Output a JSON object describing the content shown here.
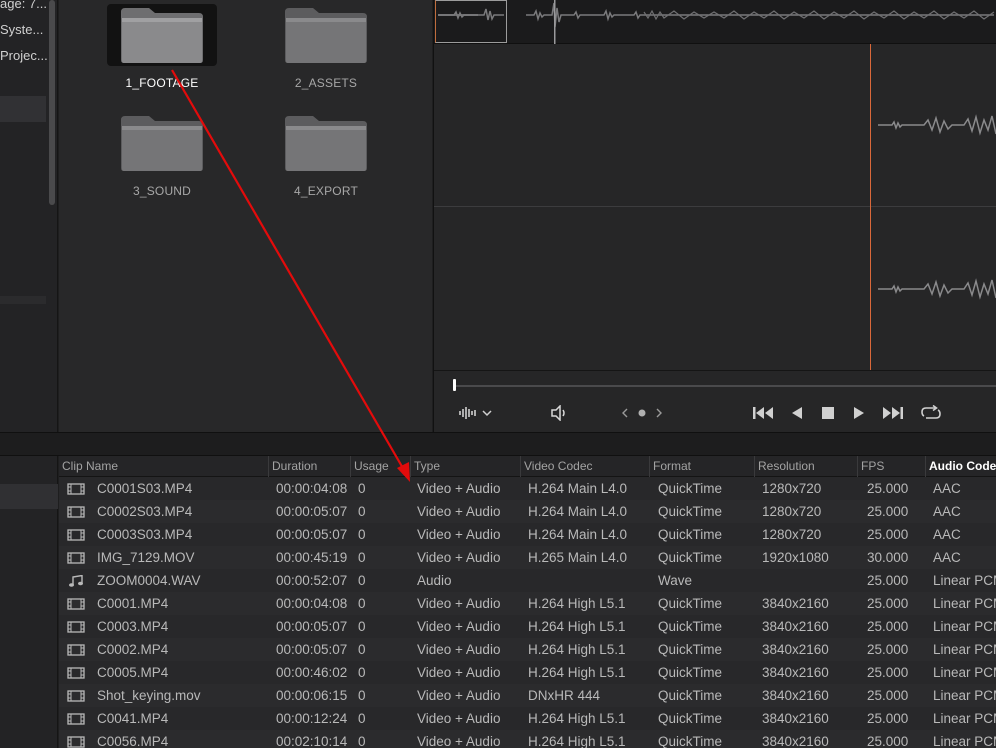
{
  "sidebar": {
    "items": [
      {
        "label": "age: 7..."
      },
      {
        "label": "Syste..."
      },
      {
        "label": "Projec..."
      }
    ]
  },
  "browser": {
    "folders": [
      {
        "name": "1_FOOTAGE",
        "selected": true
      },
      {
        "name": "2_ASSETS",
        "selected": false
      },
      {
        "name": "3_SOUND",
        "selected": false
      },
      {
        "name": "4_EXPORT",
        "selected": false
      }
    ]
  },
  "viewer": {
    "icons": {
      "audio_meter": "waveform-icon",
      "volume": "speaker-icon",
      "nav": "prev-next-dot-icon",
      "go_start": "skip-back-icon",
      "play_reverse": "play-reverse-icon",
      "stop": "stop-icon",
      "play": "play-icon",
      "go_end": "skip-forward-icon",
      "loop": "loop-icon"
    },
    "playhead_color": "#d9683a"
  },
  "annotation": {
    "color": "#e30b0b"
  },
  "clip_list": {
    "columns": [
      "Clip Name",
      "Duration",
      "Usage",
      "Type",
      "Video Codec",
      "Format",
      "Resolution",
      "FPS",
      "Audio Codec"
    ],
    "sorted_column": "Audio Codec",
    "rows": [
      {
        "icon": "film-icon",
        "name": "C0001S03.MP4",
        "duration": "00:00:04:08",
        "usage": "0",
        "type": "Video + Audio",
        "codec": "H.264 Main L4.0",
        "format": "QuickTime",
        "resolution": "1280x720",
        "fps": "25.000",
        "audio": "AAC"
      },
      {
        "icon": "film-icon",
        "name": "C0002S03.MP4",
        "duration": "00:00:05:07",
        "usage": "0",
        "type": "Video + Audio",
        "codec": "H.264 Main L4.0",
        "format": "QuickTime",
        "resolution": "1280x720",
        "fps": "25.000",
        "audio": "AAC"
      },
      {
        "icon": "film-icon",
        "name": "C0003S03.MP4",
        "duration": "00:00:05:07",
        "usage": "0",
        "type": "Video + Audio",
        "codec": "H.264 Main L4.0",
        "format": "QuickTime",
        "resolution": "1280x720",
        "fps": "25.000",
        "audio": "AAC"
      },
      {
        "icon": "film-icon",
        "name": "IMG_7129.MOV",
        "duration": "00:00:45:19",
        "usage": "0",
        "type": "Video + Audio",
        "codec": "H.265 Main L4.0",
        "format": "QuickTime",
        "resolution": "1920x1080",
        "fps": "30.000",
        "audio": "AAC"
      },
      {
        "icon": "music-note-icon",
        "name": "ZOOM0004.WAV",
        "duration": "00:00:52:07",
        "usage": "0",
        "type": "Audio",
        "codec": "",
        "format": "Wave",
        "resolution": "",
        "fps": "25.000",
        "audio": "Linear PCM"
      },
      {
        "icon": "film-icon",
        "name": "C0001.MP4",
        "duration": "00:00:04:08",
        "usage": "0",
        "type": "Video + Audio",
        "codec": "H.264 High L5.1",
        "format": "QuickTime",
        "resolution": "3840x2160",
        "fps": "25.000",
        "audio": "Linear PCM"
      },
      {
        "icon": "film-icon",
        "name": "C0003.MP4",
        "duration": "00:00:05:07",
        "usage": "0",
        "type": "Video + Audio",
        "codec": "H.264 High L5.1",
        "format": "QuickTime",
        "resolution": "3840x2160",
        "fps": "25.000",
        "audio": "Linear PCM"
      },
      {
        "icon": "film-icon",
        "name": "C0002.MP4",
        "duration": "00:00:05:07",
        "usage": "0",
        "type": "Video + Audio",
        "codec": "H.264 High L5.1",
        "format": "QuickTime",
        "resolution": "3840x2160",
        "fps": "25.000",
        "audio": "Linear PCM"
      },
      {
        "icon": "film-icon",
        "name": "C0005.MP4",
        "duration": "00:00:46:02",
        "usage": "0",
        "type": "Video + Audio",
        "codec": "H.264 High L5.1",
        "format": "QuickTime",
        "resolution": "3840x2160",
        "fps": "25.000",
        "audio": "Linear PCM"
      },
      {
        "icon": "film-icon",
        "name": "Shot_keying.mov",
        "duration": "00:00:06:15",
        "usage": "0",
        "type": "Video + Audio",
        "codec": "DNxHR 444",
        "format": "QuickTime",
        "resolution": "3840x2160",
        "fps": "25.000",
        "audio": "Linear PCM"
      },
      {
        "icon": "film-icon",
        "name": "C0041.MP4",
        "duration": "00:00:12:24",
        "usage": "0",
        "type": "Video + Audio",
        "codec": "H.264 High L5.1",
        "format": "QuickTime",
        "resolution": "3840x2160",
        "fps": "25.000",
        "audio": "Linear PCM"
      },
      {
        "icon": "film-icon",
        "name": "C0056.MP4",
        "duration": "00:02:10:14",
        "usage": "0",
        "type": "Video + Audio",
        "codec": "H.264 High L5.1",
        "format": "QuickTime",
        "resolution": "3840x2160",
        "fps": "25.000",
        "audio": "Linear PCM"
      }
    ]
  }
}
